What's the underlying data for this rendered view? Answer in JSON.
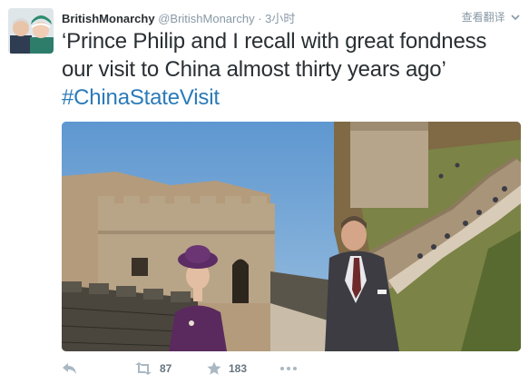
{
  "tweet": {
    "fullname": "BritishMonarchy",
    "username": "@BritishMonarchy",
    "separator": " · ",
    "time": "3小时",
    "translate_label": "查看翻译",
    "text": "‘Prince Philip and I recall with great fondness our visit to China almost thirty years ago’ ",
    "hashtag": "#ChinaStateVisit"
  },
  "actions": {
    "reply_icon": "reply-icon",
    "retweet_icon": "retweet-icon",
    "retweet_count": "87",
    "favorite_icon": "star-icon",
    "favorite_count": "183",
    "more_icon": "more-icon"
  },
  "colors": {
    "name": "#292f33",
    "muted": "#8899a6",
    "hashtag": "#2b7bb9",
    "sky": "#6aa0d2"
  }
}
